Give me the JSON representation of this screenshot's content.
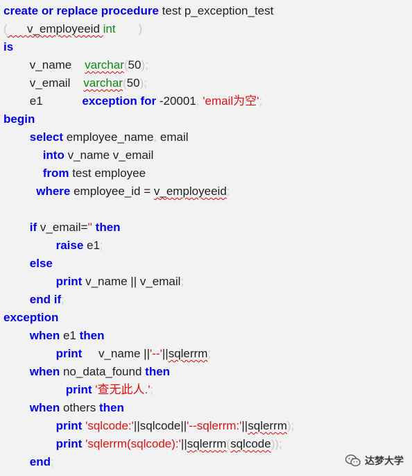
{
  "code_lines": [
    [
      {
        "t": "create or replace procedure",
        "c": "kw"
      },
      {
        "t": " test"
      },
      {
        "t": " "
      },
      {
        "t": "p_exception_test"
      }
    ],
    [
      {
        "t": "(",
        "c": "pu"
      },
      {
        "t": "      v_employeeid ",
        "c": "",
        "w": 1
      },
      {
        "t": "int",
        "c": "ty"
      },
      {
        "t": "       )",
        "c": "pu"
      }
    ],
    [
      {
        "t": "is",
        "c": "kw"
      }
    ],
    [
      {
        "t": "        v_name    "
      },
      {
        "t": "varchar",
        "c": "ty",
        "w": 1
      },
      {
        "t": "(",
        "c": "pu"
      },
      {
        "t": "50"
      },
      {
        "t": ");",
        "c": "pu"
      }
    ],
    [
      {
        "t": "        v_email    "
      },
      {
        "t": "varchar",
        "c": "ty",
        "w": 1
      },
      {
        "t": "(",
        "c": "pu"
      },
      {
        "t": "50"
      },
      {
        "t": ");",
        "c": "pu"
      }
    ],
    [
      {
        "t": "        e1            "
      },
      {
        "t": "exception for",
        "c": "kw"
      },
      {
        "t": " -20001"
      },
      {
        "t": ", ",
        "c": "pu"
      },
      {
        "t": "'email为空'",
        "c": "st"
      },
      {
        "t": ";",
        "c": "pu"
      }
    ],
    [
      {
        "t": "begin",
        "c": "kw"
      }
    ],
    [
      {
        "t": "        "
      },
      {
        "t": "select",
        "c": "kw"
      },
      {
        "t": " employee_name"
      },
      {
        "t": ", ",
        "c": "pu"
      },
      {
        "t": "email"
      }
    ],
    [
      {
        "t": "            "
      },
      {
        "t": "into",
        "c": "kw"
      },
      {
        "t": " v_name"
      },
      {
        "t": " ",
        "c": "pu"
      },
      {
        "t": "v_email"
      }
    ],
    [
      {
        "t": "            "
      },
      {
        "t": "from",
        "c": "kw"
      },
      {
        "t": " test"
      },
      {
        "t": " ",
        "c": "pu"
      },
      {
        "t": "employee"
      }
    ],
    [
      {
        "t": "          "
      },
      {
        "t": "where",
        "c": "kw"
      },
      {
        "t": " employee_id = "
      },
      {
        "t": "v_employeeid",
        "w": 1
      },
      {
        "t": ";",
        "c": "pu"
      }
    ],
    [],
    [
      {
        "t": "        "
      },
      {
        "t": "if",
        "c": "kw"
      },
      {
        "t": " v_email="
      },
      {
        "t": "''",
        "c": "st"
      },
      {
        "t": " "
      },
      {
        "t": "then",
        "c": "kw"
      }
    ],
    [
      {
        "t": "                "
      },
      {
        "t": "raise",
        "c": "kw"
      },
      {
        "t": " e1"
      },
      {
        "t": ";",
        "c": "pu"
      }
    ],
    [
      {
        "t": "        "
      },
      {
        "t": "else",
        "c": "kw"
      }
    ],
    [
      {
        "t": "                "
      },
      {
        "t": "print",
        "c": "kw"
      },
      {
        "t": " v_name || v_email"
      },
      {
        "t": ";",
        "c": "pu"
      }
    ],
    [
      {
        "t": "        "
      },
      {
        "t": "end if",
        "c": "kw"
      },
      {
        "t": ";",
        "c": "pu"
      }
    ],
    [
      {
        "t": "exception",
        "c": "kw"
      }
    ],
    [
      {
        "t": "        "
      },
      {
        "t": "when",
        "c": "kw"
      },
      {
        "t": " e1 "
      },
      {
        "t": "then",
        "c": "kw"
      }
    ],
    [
      {
        "t": "                "
      },
      {
        "t": "print",
        "c": "kw"
      },
      {
        "t": "     v_name ||"
      },
      {
        "t": "'--'",
        "c": "st"
      },
      {
        "t": "||"
      },
      {
        "t": "sqlerrm",
        "w": 1
      },
      {
        "t": ";",
        "c": "pu"
      }
    ],
    [
      {
        "t": "        "
      },
      {
        "t": "when",
        "c": "kw"
      },
      {
        "t": " no_data_found "
      },
      {
        "t": "then",
        "c": "kw"
      }
    ],
    [
      {
        "t": "                   "
      },
      {
        "t": "print",
        "c": "kw"
      },
      {
        "t": " "
      },
      {
        "t": "'查无此人.'",
        "c": "st"
      },
      {
        "t": ";",
        "c": "pu"
      }
    ],
    [
      {
        "t": "        "
      },
      {
        "t": "when",
        "c": "kw"
      },
      {
        "t": " others "
      },
      {
        "t": "then",
        "c": "kw"
      }
    ],
    [
      {
        "t": "                "
      },
      {
        "t": "print",
        "c": "kw"
      },
      {
        "t": " "
      },
      {
        "t": "'sqlcode:'",
        "c": "st"
      },
      {
        "t": "||sqlcode||"
      },
      {
        "t": "'--sqlerrm:'",
        "c": "st"
      },
      {
        "t": "||"
      },
      {
        "t": "sqlerrm",
        "w": 1
      },
      {
        "t": ");",
        "c": "pu"
      }
    ],
    [
      {
        "t": "                "
      },
      {
        "t": "print",
        "c": "kw"
      },
      {
        "t": " "
      },
      {
        "t": "'sqlerrm(sqlcode):'",
        "c": "st"
      },
      {
        "t": "||"
      },
      {
        "t": "sqlerrm",
        "w": 1
      },
      {
        "t": "(",
        "c": "pu"
      },
      {
        "t": "sqlcode",
        "w": 1
      },
      {
        "t": "));",
        "c": "pu"
      }
    ],
    [
      {
        "t": "        "
      },
      {
        "t": "end",
        "c": "kw"
      },
      {
        "t": ";",
        "c": "pu"
      }
    ]
  ],
  "watermark": {
    "text": "达梦大学",
    "icon": "wechat-icon"
  },
  "colors": {
    "keyword": "#0000ee",
    "type": "#118811",
    "string": "#dd1111",
    "punct": "#c8c8c8",
    "text": "#1f1f1f",
    "background": "#f2f2f2"
  }
}
